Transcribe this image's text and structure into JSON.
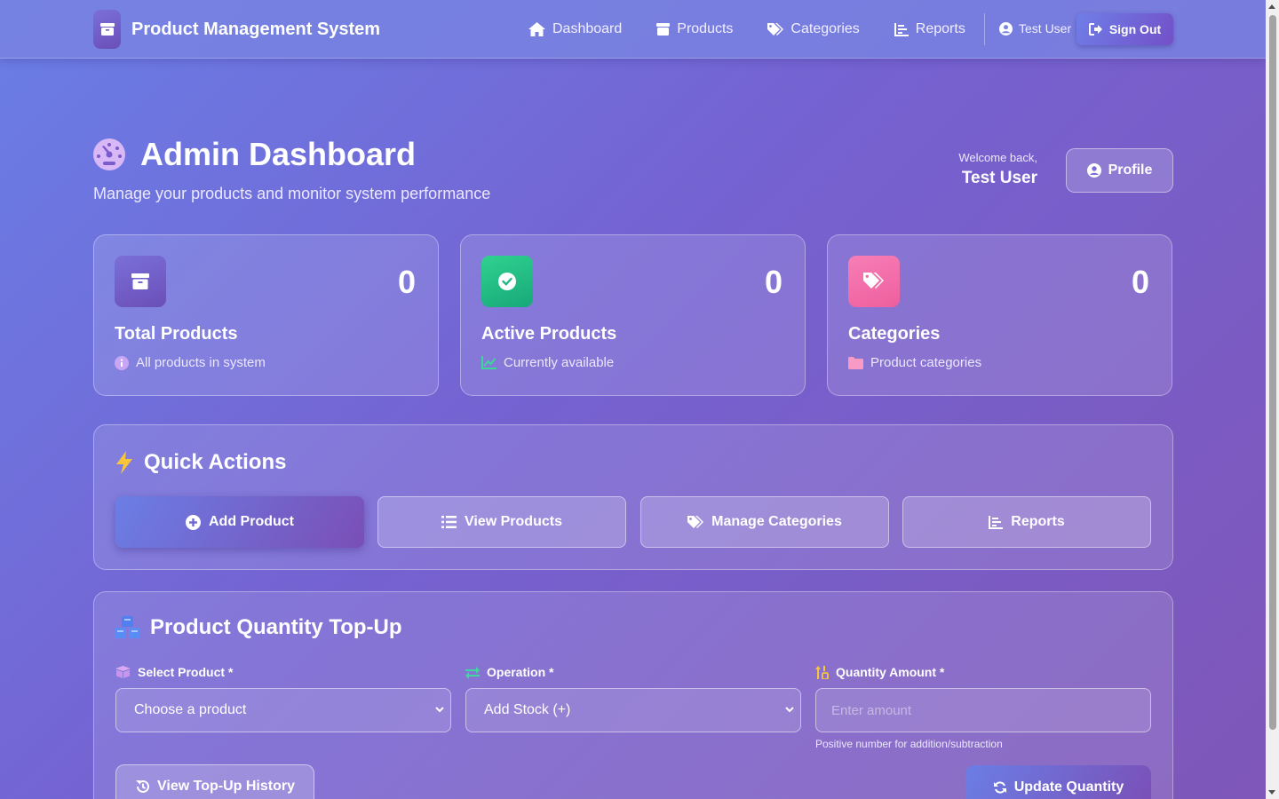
{
  "navbar": {
    "brand": "Product Management System",
    "links": [
      {
        "label": "Dashboard",
        "icon": "home-icon"
      },
      {
        "label": "Products",
        "icon": "box-icon"
      },
      {
        "label": "Categories",
        "icon": "tags-icon"
      },
      {
        "label": "Reports",
        "icon": "chart-icon"
      }
    ],
    "user": "Test User",
    "signout": "Sign Out"
  },
  "header": {
    "title": "Admin Dashboard",
    "subtitle": "Manage your products and monitor system performance",
    "welcome": "Welcome back,",
    "user_name": "Test User",
    "profile_button": "Profile"
  },
  "stats": [
    {
      "value": "0",
      "label": "Total Products",
      "sub": "All products in system",
      "icon": "box-icon",
      "color": "#7b6fd8"
    },
    {
      "value": "0",
      "label": "Active Products",
      "sub": "Currently available",
      "icon": "check-circle-icon",
      "color": "#22c08a"
    },
    {
      "value": "0",
      "label": "Categories",
      "sub": "Product categories",
      "icon": "tags-icon",
      "color": "#f06aa8"
    }
  ],
  "quick_actions": {
    "title": "Quick Actions",
    "buttons": [
      "Add Product",
      "View Products",
      "Manage Categories",
      "Reports"
    ]
  },
  "topup": {
    "title": "Product Quantity Top-Up",
    "product_label": "Select Product *",
    "product_value": "Choose a product",
    "operation_label": "Operation *",
    "operation_value": "Add Stock (+)",
    "quantity_label": "Quantity Amount *",
    "quantity_placeholder": "Enter amount",
    "hint": "Positive number for addition/subtraction",
    "history_button": "View Top-Up History",
    "update_button": "Update Quantity"
  }
}
